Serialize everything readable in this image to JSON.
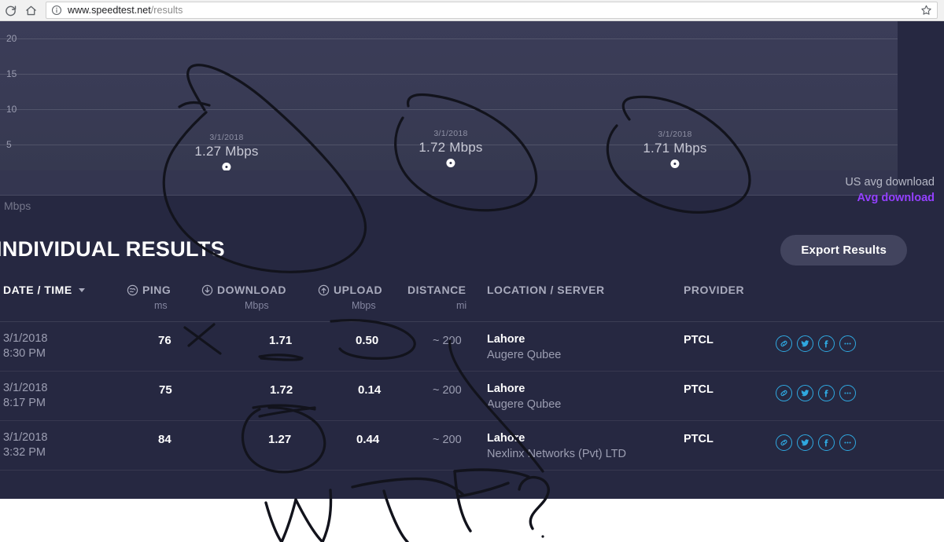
{
  "browser": {
    "reload_icon": "reload-icon",
    "home_icon": "home-icon",
    "info_icon": "info-icon",
    "star_icon": "star-icon",
    "url_domain": "www.speedtest.net",
    "url_path": "/results"
  },
  "chart": {
    "unit_label": "Mbps",
    "legend": {
      "us_avg": "US avg download",
      "avg": "Avg download",
      "us_avg_color": "#b6b8c6",
      "avg_color": "#9440ff"
    }
  },
  "chart_data": {
    "type": "line",
    "title": "",
    "xlabel": "",
    "ylabel": "Mbps",
    "ylim": [
      0,
      22
    ],
    "yticks": [
      5,
      10,
      15,
      20
    ],
    "grid": true,
    "legend_position": "bottom-right",
    "points": [
      {
        "date": "3/1/2018",
        "label": "1.27 Mbps",
        "value": 1.27
      },
      {
        "date": "3/1/2018",
        "label": "1.72 Mbps",
        "value": 1.72
      },
      {
        "date": "3/1/2018",
        "label": "1.71 Mbps",
        "value": 1.71
      }
    ],
    "series": [
      {
        "name": "Avg download",
        "values": [
          1.27,
          1.72,
          1.71
        ]
      }
    ]
  },
  "results": {
    "title": "INDIVIDUAL RESULTS",
    "export_label": "Export Results",
    "columns": {
      "date_time": "DATE / TIME",
      "ping": "PING",
      "ping_unit": "ms",
      "download": "DOWNLOAD",
      "download_unit": "Mbps",
      "upload": "UPLOAD",
      "upload_unit": "Mbps",
      "distance": "DISTANCE",
      "distance_unit": "mi",
      "location": "LOCATION / SERVER",
      "provider": "PROVIDER"
    },
    "rows": [
      {
        "date": "3/1/2018",
        "time": "8:30 PM",
        "ping": "76",
        "download": "1.71",
        "upload": "0.50",
        "distance": "~ 200",
        "city": "Lahore",
        "server": "Augere Qubee",
        "provider": "PTCL"
      },
      {
        "date": "3/1/2018",
        "time": "8:17 PM",
        "ping": "75",
        "download": "1.72",
        "upload": "0.14",
        "distance": "~ 200",
        "city": "Lahore",
        "server": "Augere Qubee",
        "provider": "PTCL"
      },
      {
        "date": "3/1/2018",
        "time": "3:32 PM",
        "ping": "84",
        "download": "1.27",
        "upload": "0.44",
        "distance": "~ 200",
        "city": "Lahore",
        "server": "Nexlinx Networks (Pvt) LTD",
        "provider": "PTCL"
      }
    ],
    "row_actions": [
      "link-icon",
      "twitter-icon",
      "facebook-icon",
      "more-icon"
    ]
  },
  "annotation": {
    "text": "WTF?",
    "ink_color": "#12131c"
  }
}
